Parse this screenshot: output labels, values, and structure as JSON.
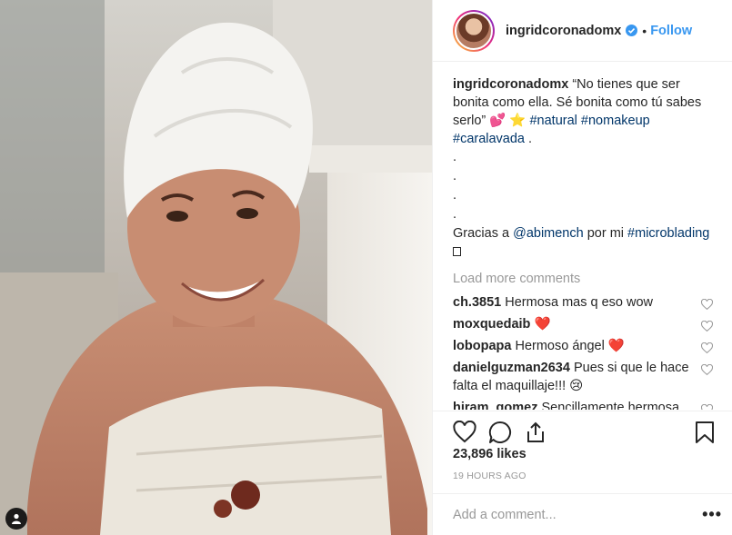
{
  "post": {
    "username": "ingridcoronadomx",
    "follow_label": "Follow",
    "dot": "•"
  },
  "caption": {
    "username": "ingridcoronadomx",
    "text_1": "“No tienes que ser bonita como ella. Sé bonita como tú sabes serlo”",
    "emoji_1": "💕",
    "emoji_2": "⭐",
    "tags": [
      "#natural",
      "#nomakeup",
      "#caralavada"
    ],
    "end": ".",
    "dots": [
      ".",
      ".",
      ".",
      "."
    ],
    "thanks_prefix": "Gracias a",
    "mention": "@abimench",
    "thanks_mid": "por mi",
    "tag_last": "#microblading"
  },
  "load_more": "Load more comments",
  "comments": [
    {
      "user": "ch.3851",
      "text": "Hermosa mas q eso wow",
      "emoji": ""
    },
    {
      "user": "moxquedaib",
      "text": "",
      "emoji": "❤️"
    },
    {
      "user": "lobopapa",
      "text": "Hermoso ángel",
      "emoji": "❤️"
    },
    {
      "user": "danielguzman2634",
      "text": "Pues si que le hace falta el maquillaje!!!",
      "emoji": "😢"
    },
    {
      "user": "hiram_gomez",
      "text": "Sencillamente hermosa besos te amo aún mas",
      "emoji": ""
    }
  ],
  "likes": "23,896 likes",
  "time": "19 HOURS AGO",
  "add_comment_placeholder": "Add a comment...",
  "more_label": "•••",
  "colors": {
    "link": "#003569",
    "follow": "#3897f0",
    "muted": "#999999"
  }
}
